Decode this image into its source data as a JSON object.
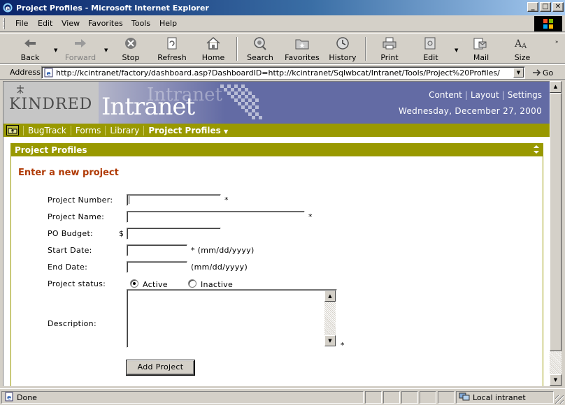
{
  "window": {
    "title": "Project Profiles - Microsoft Internet Explorer",
    "buttons": {
      "minimize": "_",
      "maximize": "□",
      "close": "✕"
    }
  },
  "menu": [
    "File",
    "Edit",
    "View",
    "Favorites",
    "Tools",
    "Help"
  ],
  "toolbar": {
    "back": "Back",
    "forward": "Forward",
    "stop": "Stop",
    "refresh": "Refresh",
    "home": "Home",
    "search": "Search",
    "favorites": "Favorites",
    "history": "History",
    "print": "Print",
    "edit": "Edit",
    "mail": "Mail",
    "size": "Size"
  },
  "address": {
    "label": "Address",
    "url": "http://kcintranet/factory/dashboard.asp?DashboardID=http://kcintranet/Sqlwbcat/Intranet/Tools/Project%20Profiles/",
    "go": "Go"
  },
  "header": {
    "logo": "KINDRED",
    "brand": "Intranet",
    "links": [
      "Content",
      "Layout",
      "Settings"
    ],
    "date": "Wednesday, December 27, 2000"
  },
  "nav": {
    "items": [
      "BugTrack",
      "Forms",
      "Library"
    ],
    "active": "Project Profiles"
  },
  "portlet": {
    "title": "Project Profiles",
    "heading": "Enter a new project",
    "fields": {
      "project_number": {
        "label": "Project Number:",
        "value": "",
        "required": "*"
      },
      "project_name": {
        "label": "Project Name:",
        "value": "",
        "required": "*"
      },
      "po_budget": {
        "label": "PO Budget:",
        "prefix": "$",
        "value": ""
      },
      "start_date": {
        "label": "Start Date:",
        "value": "",
        "hint": "* (mm/dd/yyyy)"
      },
      "end_date": {
        "label": "End Date:",
        "value": "",
        "hint": "(mm/dd/yyyy)"
      },
      "status": {
        "label": "Project status:",
        "options": [
          "Active",
          "Inactive"
        ],
        "selected": "Active"
      },
      "description": {
        "label": "Description:",
        "value": "",
        "required": "*"
      }
    },
    "submit": "Add Project"
  },
  "status": {
    "text": "Done",
    "zone": "Local intranet"
  },
  "colors": {
    "header_bg": "#636ba4",
    "nav_bg": "#999900",
    "heading": "#b03a05"
  }
}
